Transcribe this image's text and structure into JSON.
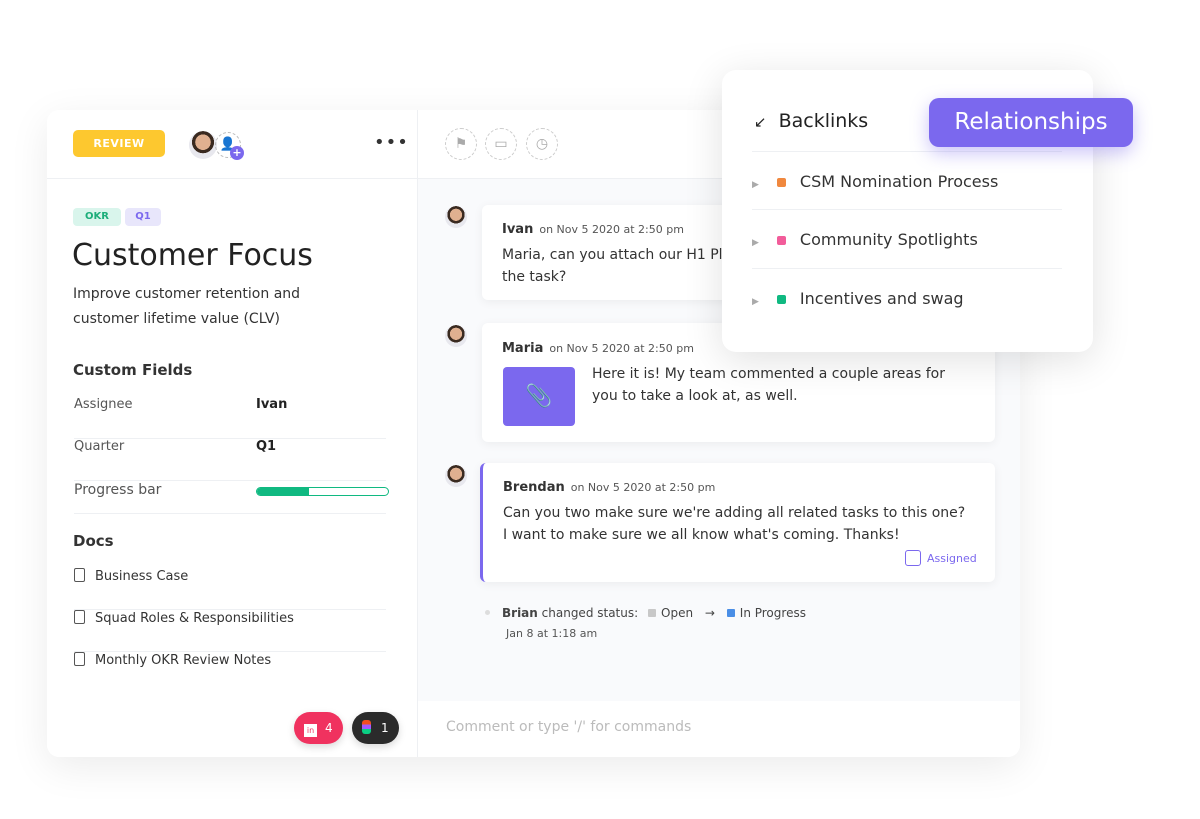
{
  "header": {
    "status": "REVIEW",
    "more": "•••",
    "icons": [
      "flag-icon",
      "calendar-icon",
      "clock-icon"
    ]
  },
  "task": {
    "tags": [
      "OKR",
      "Q1"
    ],
    "title": "Customer Focus",
    "description_lines": [
      "Improve customer retention and",
      "customer lifetime value (CLV)"
    ]
  },
  "custom_fields": {
    "heading": "Custom Fields",
    "fields": [
      {
        "label": "Assignee",
        "value": "Ivan"
      },
      {
        "label": "Quarter",
        "value": "Q1"
      },
      {
        "label": "Progress bar",
        "progress": 0.4
      }
    ]
  },
  "docs": {
    "heading": "Docs",
    "items": [
      "Business Case",
      "Squad Roles & Responsibilities",
      "Monthly OKR Review Notes"
    ]
  },
  "footer": {
    "invision_count": "4",
    "figma_count": "1",
    "comment_placeholder": "Comment or type '/' for commands"
  },
  "comments": [
    {
      "name": "Ivan",
      "date": "on Nov 5 2020 at 2:50 pm",
      "lines": [
        "Maria, can you attach our H1 Pl",
        "the task?"
      ]
    },
    {
      "name": "Maria",
      "date": "on Nov 5 2020 at 2:50 pm",
      "lines": [
        "Here it is! My team commented a couple areas for",
        "you to take a look at, as well."
      ]
    },
    {
      "name": "Brendan",
      "date": "on Nov 5 2020 at 2:50 pm",
      "lines": [
        "Can you two make sure we're adding all related tasks to this one?",
        "I want to make sure we all know what's coming. Thanks!"
      ],
      "assigned": "Assigned"
    }
  ],
  "activity": {
    "user": "Brian",
    "action": "changed status:",
    "from": "Open",
    "to": "In Progress",
    "time": "Jan 8 at 1:18 am"
  },
  "backlinks": {
    "title": "Backlinks",
    "items": [
      {
        "label": "CSM Nomination Process",
        "color": "#f0883e"
      },
      {
        "label": "Community Spotlights",
        "color": "#f25c9a"
      },
      {
        "label": "Incentives and swag",
        "color": "#10b981"
      }
    ]
  },
  "relationships": "Relationships",
  "colors": {
    "accent": "#7b68ee",
    "review": "#fdc82f",
    "progress": "#10b981"
  }
}
